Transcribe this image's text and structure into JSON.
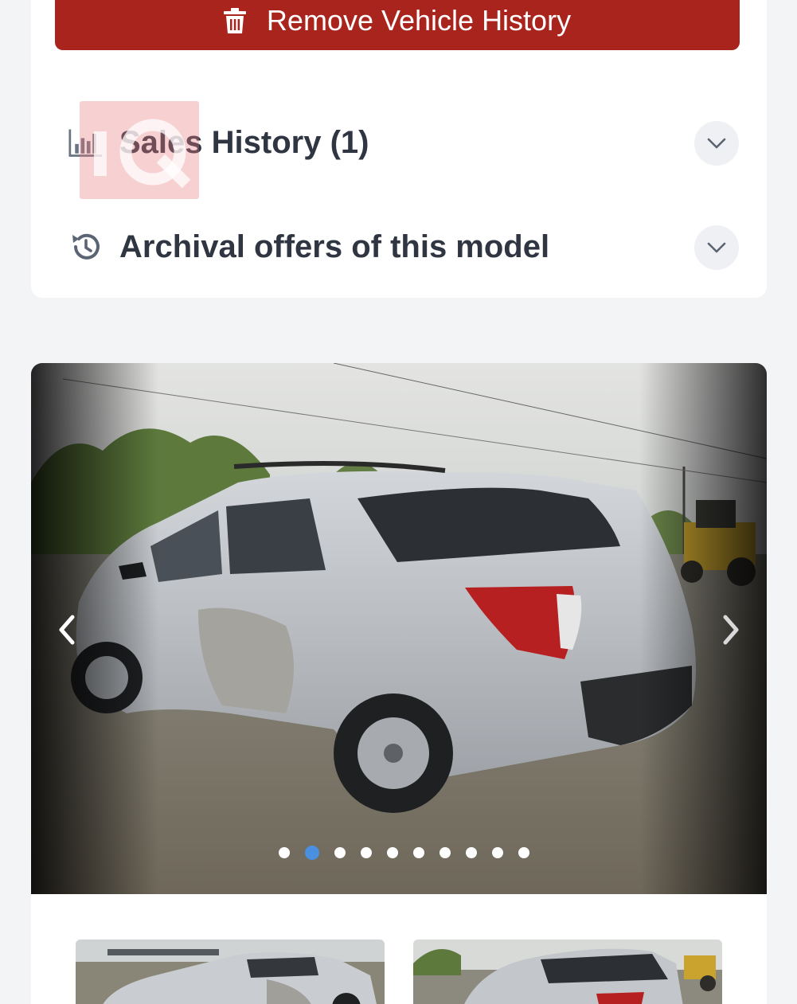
{
  "remove_button": {
    "label": "Remove Vehicle History",
    "icon": "trash-icon",
    "color": "#a8241c"
  },
  "accordion": {
    "sales_history": {
      "title": "Sales History (1)",
      "icon": "bar-chart-icon"
    },
    "archival_offers": {
      "title": "Archival offers of this model",
      "icon": "history-icon"
    }
  },
  "logo": {
    "text": "IQ"
  },
  "gallery": {
    "image": "silver-suv-damaged-rear-three-quarter-photo",
    "dots_count": 10,
    "active_index": 1,
    "active_color": "#4a8fe0",
    "thumbnails": [
      "silver-suv-front-three-quarter-thumbnail",
      "silver-suv-rear-three-quarter-thumbnail"
    ]
  }
}
